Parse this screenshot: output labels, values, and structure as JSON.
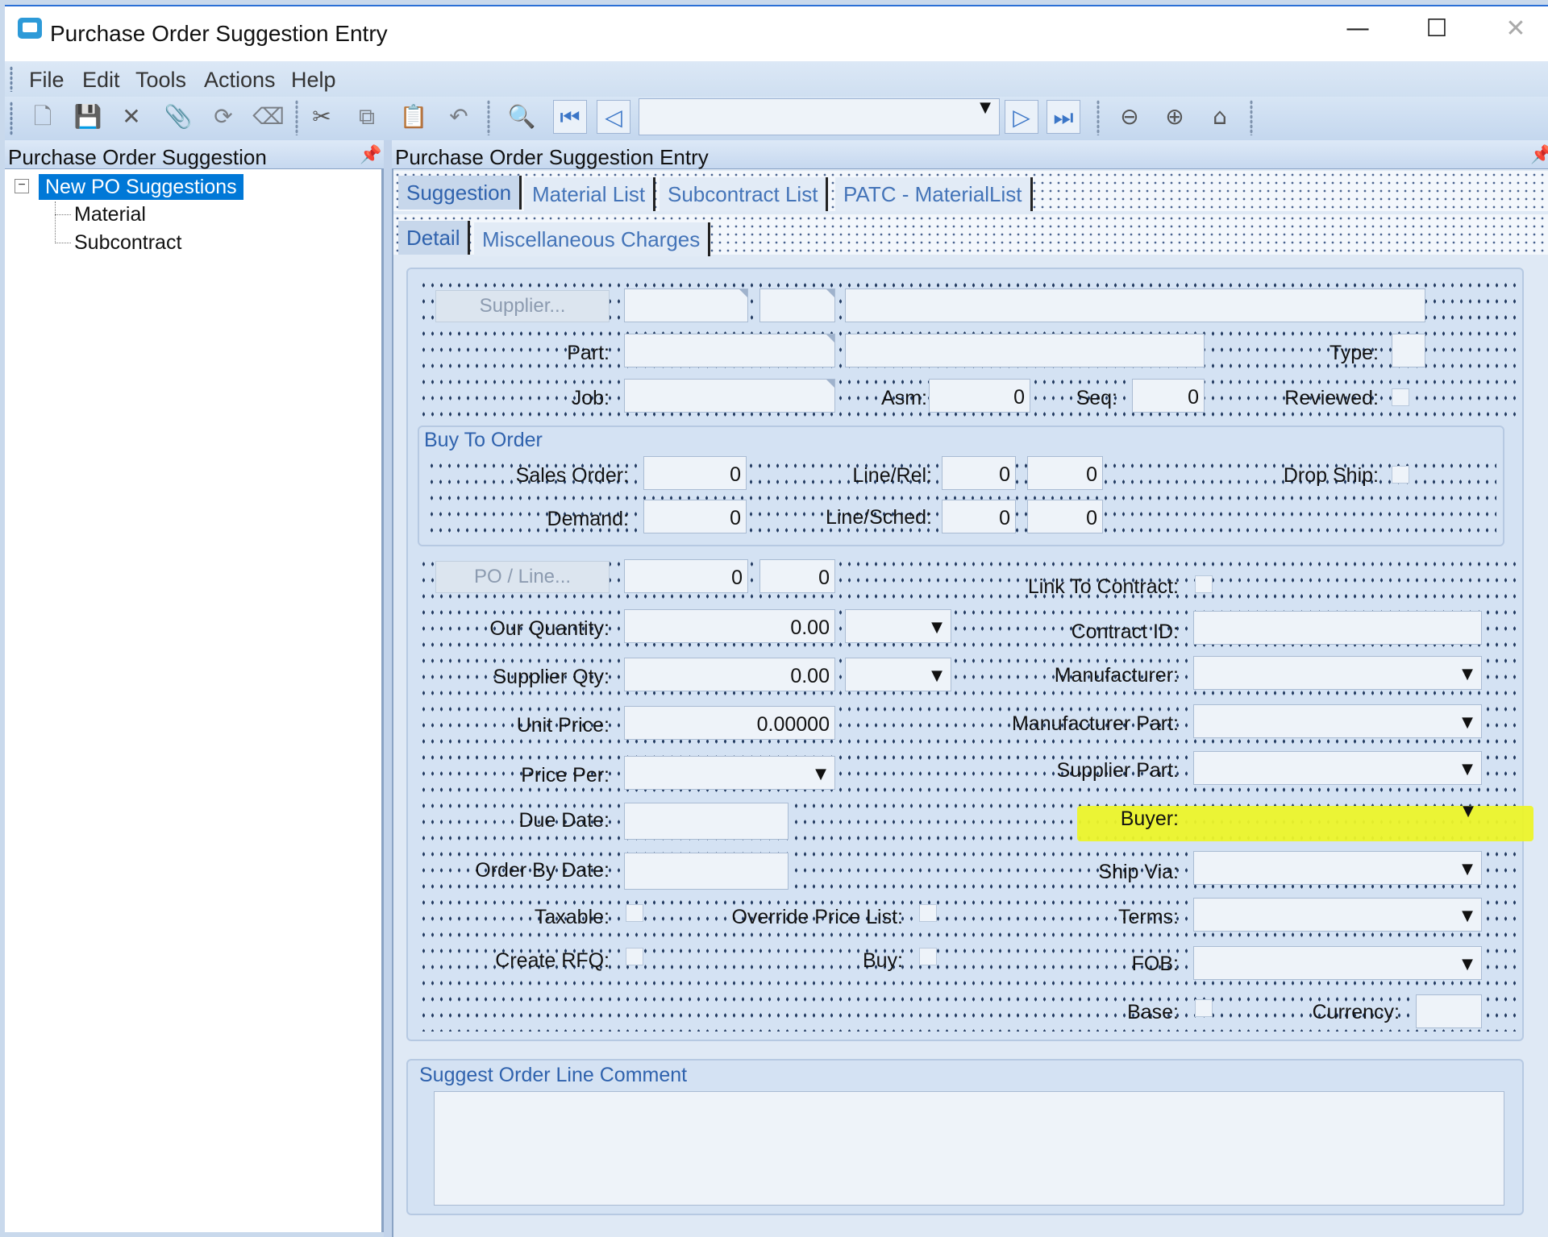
{
  "window": {
    "title": "Purchase Order Suggestion Entry",
    "minimize_glyph": "—",
    "maximize_glyph": "☐",
    "close_glyph": "✕"
  },
  "menu": [
    "File",
    "Edit",
    "Tools",
    "Actions",
    "Help"
  ],
  "toolbar": {
    "icons": [
      "new-icon",
      "save-icon",
      "delete-icon",
      "attach-icon",
      "refresh-icon",
      "clear-icon",
      "cut-icon",
      "copy-icon",
      "paste-icon",
      "undo-icon",
      "search-icon",
      "first-record-icon",
      "previous-record-icon",
      "next-record-icon",
      "last-record-icon",
      "back-icon",
      "forward-icon",
      "home-icon"
    ],
    "navigation_value": ""
  },
  "tree": {
    "header": "Purchase Order Suggestion",
    "root": "New PO Suggestions",
    "children": [
      "Material",
      "Subcontract"
    ]
  },
  "right": {
    "header": "Purchase Order Suggestion Entry",
    "tabs": [
      "Suggestion",
      "Material List",
      "Subcontract List",
      "PATC - MaterialList"
    ],
    "subtabs": [
      "Detail",
      "Miscellaneous Charges"
    ]
  },
  "form": {
    "supplier_button": "Supplier...",
    "part_label": "Part:",
    "type_label": "Type:",
    "job_label": "Job:",
    "asm_label": "Asm:",
    "asm_value": "0",
    "seq_label": "Seq:",
    "seq_value": "0",
    "reviewed_label": "Reviewed:",
    "buy_to_order": {
      "title": "Buy To Order",
      "sales_order_label": "Sales Order:",
      "sales_order_value": "0",
      "line_rel_label": "Line/Rel:",
      "line_value": "0",
      "rel_value": "0",
      "drop_ship_label": "Drop Ship:",
      "demand_label": "Demand:",
      "demand_value": "0",
      "line_sched_label": "Line/Sched:",
      "demand_line_value": "0",
      "sched_value": "0"
    },
    "po_line_button": "PO / Line...",
    "po_value": "0",
    "po_line_value": "0",
    "link_to_contract_label": "Link To Contract:",
    "our_quantity_label": "Our Quantity:",
    "our_quantity_value": "0.00",
    "contract_id_label": "Contract ID:",
    "supplier_qty_label": "Supplier Qty:",
    "supplier_qty_value": "0.00",
    "manufacturer_label": "Manufacturer:",
    "unit_price_label": "Unit Price:",
    "unit_price_value": "0.00000",
    "manufacturer_part_label": "Manufacturer Part:",
    "price_per_label": "Price Per:",
    "supplier_part_label": "Supplier Part:",
    "due_date_label": "Due Date:",
    "buyer_label": "Buyer:",
    "order_by_date_label": "Order By Date:",
    "ship_via_label": "Ship Via:",
    "taxable_label": "Taxable:",
    "override_price_list_label": "Override Price List:",
    "terms_label": "Terms:",
    "create_rfq_label": "Create RFQ:",
    "buy_label": "Buy:",
    "fob_label": "FOB:",
    "base_label": "Base:",
    "currency_label": "Currency:"
  },
  "comment": {
    "title": "Suggest Order Line Comment",
    "value": ""
  },
  "colors": {
    "highlight": "#ecf42a",
    "tree_selection": "#0078d7",
    "tab_text": "#4474b8"
  }
}
